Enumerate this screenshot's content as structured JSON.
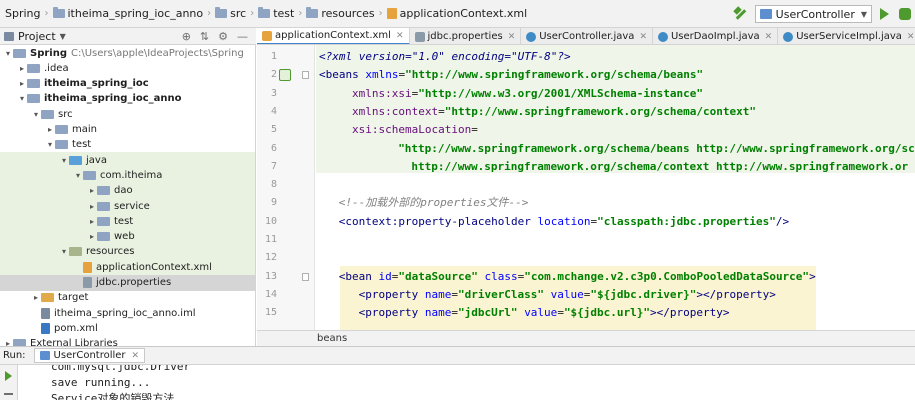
{
  "breadcrumb": [
    "Spring",
    "itheima_spring_ioc_anno",
    "src",
    "test",
    "resources",
    "applicationContext.xml"
  ],
  "toolbar": {
    "run_config": "UserController"
  },
  "project_panel": {
    "title": "Project"
  },
  "tree": [
    {
      "label": "Spring",
      "path": "C:\\Users\\apple\\IdeaProjects\\Spring",
      "indent": 0,
      "arrow": "▾",
      "icon": "folder",
      "bold": true
    },
    {
      "label": ".idea",
      "indent": 1,
      "arrow": "▸",
      "icon": "folder"
    },
    {
      "label": "itheima_spring_ioc",
      "indent": 1,
      "arrow": "▸",
      "icon": "folder",
      "bold": true
    },
    {
      "label": "itheima_spring_ioc_anno",
      "indent": 1,
      "arrow": "▾",
      "icon": "folder",
      "bold": true
    },
    {
      "label": "src",
      "indent": 2,
      "arrow": "▾",
      "icon": "folder"
    },
    {
      "label": "main",
      "indent": 3,
      "arrow": "▸",
      "icon": "folder"
    },
    {
      "label": "test",
      "indent": 3,
      "arrow": "▾",
      "icon": "folder"
    },
    {
      "label": "java",
      "indent": 4,
      "arrow": "▾",
      "icon": "src",
      "hl": true
    },
    {
      "label": "com.itheima",
      "indent": 5,
      "arrow": "▾",
      "icon": "folder",
      "hl": true
    },
    {
      "label": "dao",
      "indent": 6,
      "arrow": "▸",
      "icon": "folder",
      "hl": true
    },
    {
      "label": "service",
      "indent": 6,
      "arrow": "▸",
      "icon": "folder",
      "hl": true
    },
    {
      "label": "test",
      "indent": 6,
      "arrow": "▸",
      "icon": "folder",
      "hl": true
    },
    {
      "label": "web",
      "indent": 6,
      "arrow": "▸",
      "icon": "folder",
      "hl": true
    },
    {
      "label": "resources",
      "indent": 4,
      "arrow": "▾",
      "icon": "res",
      "hl": true
    },
    {
      "label": "applicationContext.xml",
      "indent": 5,
      "arrow": "",
      "icon": "xml",
      "hl": true
    },
    {
      "label": "jdbc.properties",
      "indent": 5,
      "arrow": "",
      "icon": "props",
      "sel": true
    },
    {
      "label": "target",
      "indent": 2,
      "arrow": "▸",
      "icon": "orange"
    },
    {
      "label": "itheima_spring_ioc_anno.iml",
      "indent": 2,
      "arrow": "",
      "icon": "iml"
    },
    {
      "label": "pom.xml",
      "indent": 2,
      "arrow": "",
      "icon": "pom"
    },
    {
      "label": "External Libraries",
      "indent": 0,
      "arrow": "▸",
      "icon": "folder"
    }
  ],
  "tabs": [
    {
      "label": "applicationContext.xml",
      "icon": "xml",
      "active": true
    },
    {
      "label": "jdbc.properties",
      "icon": "props"
    },
    {
      "label": "UserController.java",
      "icon": "java"
    },
    {
      "label": "UserDaoImpl.java",
      "icon": "java"
    },
    {
      "label": "UserServiceImpl.java",
      "icon": "java"
    }
  ],
  "code_lines": [
    {
      "n": "1",
      "indent": 0,
      "tokens": [
        [
          "pi",
          "<?xml version=\"1.0\" encoding=\"UTF-8\"?>"
        ]
      ]
    },
    {
      "n": "2",
      "indent": 0,
      "tokens": [
        [
          "tag",
          "<beans "
        ],
        [
          "attr",
          "xmlns"
        ],
        [
          "plain",
          "="
        ],
        [
          "val",
          "\"http://www.springframework.org/schema/beans\""
        ]
      ]
    },
    {
      "n": "3",
      "indent": 5,
      "tokens": [
        [
          "ns",
          "xmlns:xsi"
        ],
        [
          "plain",
          "="
        ],
        [
          "val",
          "\"http://www.w3.org/2001/XMLSchema-instance\""
        ]
      ]
    },
    {
      "n": "4",
      "indent": 5,
      "tokens": [
        [
          "ns",
          "xmlns:context"
        ],
        [
          "plain",
          "="
        ],
        [
          "val",
          "\"http://www.springframework.org/schema/context\""
        ]
      ]
    },
    {
      "n": "5",
      "indent": 5,
      "tokens": [
        [
          "ns",
          "xsi:schemaLocation"
        ],
        [
          "plain",
          "="
        ]
      ]
    },
    {
      "n": "6",
      "indent": 12,
      "tokens": [
        [
          "val",
          "\"http://www.springframework.org/schema/beans http://www.springframework.org/sc"
        ]
      ]
    },
    {
      "n": "7",
      "indent": 14,
      "tokens": [
        [
          "val",
          "http://www.springframework.org/schema/context http://www.springframework.or"
        ]
      ]
    },
    {
      "n": "8",
      "indent": 0,
      "tokens": []
    },
    {
      "n": "9",
      "indent": 3,
      "tokens": [
        [
          "cm",
          "<!--加载外部的properties文件-->"
        ]
      ]
    },
    {
      "n": "10",
      "indent": 3,
      "tokens": [
        [
          "tag",
          "<context:property-placeholder "
        ],
        [
          "attr",
          "location"
        ],
        [
          "plain",
          "="
        ],
        [
          "val",
          "\"classpath:jdbc.properties\""
        ],
        [
          "tag",
          "/>"
        ]
      ]
    },
    {
      "n": "11",
      "indent": 0,
      "tokens": []
    },
    {
      "n": "12",
      "indent": 0,
      "tokens": []
    },
    {
      "n": "13",
      "indent": 3,
      "tokens": [
        [
          "tag",
          "<bean "
        ],
        [
          "attr",
          "id"
        ],
        [
          "plain",
          "="
        ],
        [
          "val",
          "\"dataSource\""
        ],
        [
          "plain",
          " "
        ],
        [
          "attr",
          "class"
        ],
        [
          "plain",
          "="
        ],
        [
          "val",
          "\"com.mchange.v2.c3p0.ComboPooledDataSource\""
        ],
        [
          "tag",
          ">"
        ]
      ]
    },
    {
      "n": "14",
      "indent": 6,
      "tokens": [
        [
          "tag",
          "<property "
        ],
        [
          "attr",
          "name"
        ],
        [
          "plain",
          "="
        ],
        [
          "val",
          "\"driverClass\""
        ],
        [
          "plain",
          " "
        ],
        [
          "attr",
          "value"
        ],
        [
          "plain",
          "="
        ],
        [
          "val",
          "\"${jdbc.driver}\""
        ],
        [
          "tag",
          "></property>"
        ]
      ]
    },
    {
      "n": "15",
      "indent": 6,
      "tokens": [
        [
          "tag",
          "<property "
        ],
        [
          "attr",
          "name"
        ],
        [
          "plain",
          "="
        ],
        [
          "val",
          "\"jdbcUrl\""
        ],
        [
          "plain",
          " "
        ],
        [
          "attr",
          "value"
        ],
        [
          "plain",
          "="
        ],
        [
          "val",
          "\"${jdbc.url}\""
        ],
        [
          "tag",
          "></property>"
        ]
      ]
    }
  ],
  "editor_status": "beans",
  "run_panel": {
    "label": "Run:",
    "tab": "UserController",
    "console_lines": [
      "com.mysql.jdbc.Driver",
      "save running...",
      "Service对象的销毁方法"
    ]
  }
}
